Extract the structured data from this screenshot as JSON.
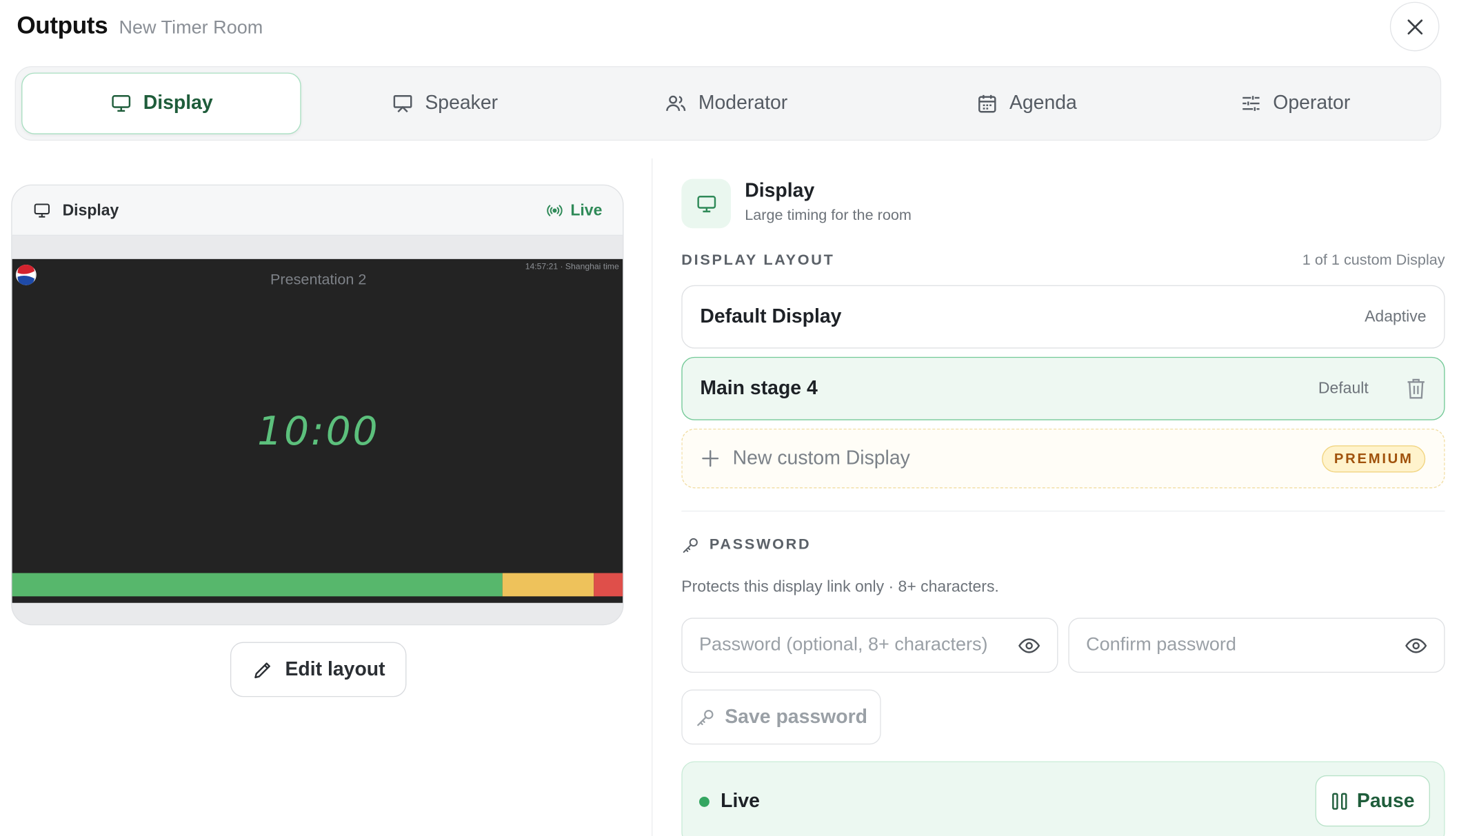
{
  "header": {
    "title": "Outputs",
    "subtitle": "New Timer Room"
  },
  "tabs": [
    {
      "label": "Display",
      "icon": "monitor-icon",
      "active": true
    },
    {
      "label": "Speaker",
      "icon": "presentation-icon",
      "active": false
    },
    {
      "label": "Moderator",
      "icon": "users-icon",
      "active": false
    },
    {
      "label": "Agenda",
      "icon": "calendar-icon",
      "active": false
    },
    {
      "label": "Operator",
      "icon": "sliders-icon",
      "active": false
    }
  ],
  "preview": {
    "label": "Display",
    "live_label": "Live",
    "screen_title": "Presentation 2",
    "clock": "14:57:21 · Shanghai time",
    "time": "10:00",
    "bar_fractions": {
      "green": 0.8,
      "yellow": 0.15,
      "red": 0.05
    }
  },
  "edit_button": "Edit layout",
  "panel": {
    "title": "Display",
    "subtitle": "Large timing for the room",
    "layout_section": "DISPLAY LAYOUT",
    "layout_count": "1 of 1 custom Display",
    "layouts": [
      {
        "name": "Default Display",
        "tag": "Adaptive",
        "selected": false
      },
      {
        "name": "Main stage 4",
        "tag": "Default",
        "selected": true
      }
    ],
    "new_custom": "New custom Display",
    "premium": "PREMIUM"
  },
  "password": {
    "section": "PASSWORD",
    "description": "Protects this display link only · 8+ characters.",
    "placeholder": "Password (optional, 8+ characters)",
    "confirm_placeholder": "Confirm password",
    "save": "Save password"
  },
  "status": {
    "label": "Live",
    "pause": "Pause"
  },
  "colors": {
    "accent": "#2f8a58",
    "screen_bg": "#232323",
    "green": "#57b76c",
    "yellow": "#eec25b",
    "red": "#df4f4a",
    "premium": "#a0520c"
  }
}
